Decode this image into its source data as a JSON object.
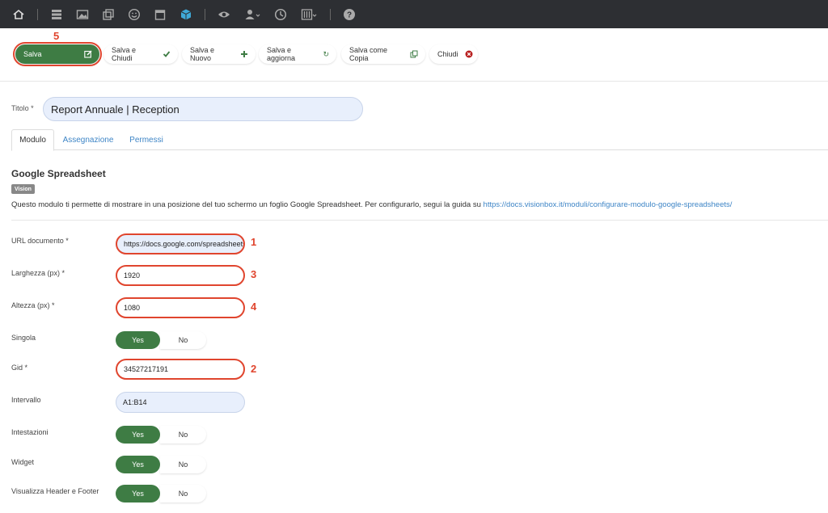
{
  "topbar": {
    "icons": [
      "home-icon",
      "list-icon",
      "image-icon",
      "copy-icon",
      "smile-icon",
      "calendar-icon",
      "cube-icon",
      "eye-icon",
      "user-icon",
      "clock-icon",
      "sliders-icon",
      "help-icon"
    ]
  },
  "toolbar": {
    "save": "Salva",
    "save_close": "Salva e Chiudi",
    "save_new": "Salva e Nuovo",
    "save_update": "Salva e aggiorna",
    "save_copy": "Salva come Copia",
    "close": "Chiudi"
  },
  "markers": {
    "m5": "5",
    "m1": "1",
    "m3": "3",
    "m4": "4",
    "m2": "2"
  },
  "title": {
    "label": "Titolo *",
    "value": "Report Annuale | Reception"
  },
  "tabs": [
    "Modulo",
    "Assegnazione",
    "Permessi"
  ],
  "section": {
    "title": "Google Spreadsheet",
    "badge": "Vision",
    "description": "Questo modulo ti permette di mostrare in una posizione del tuo schermo un foglio Google Spreadsheet. Per configurarlo, segui la guida su ",
    "link": "https://docs.visionbox.it/moduli/configurare-modulo-google-spreadsheets/"
  },
  "fields": {
    "url": {
      "label": "URL documento *",
      "value": "https://docs.google.com/spreadsheets"
    },
    "width": {
      "label": "Larghezza (px) *",
      "value": "1920"
    },
    "height": {
      "label": "Altezza (px) *",
      "value": "1080"
    },
    "single": {
      "label": "Singola",
      "yes": "Yes",
      "no": "No"
    },
    "gid": {
      "label": "Gid *",
      "value": "34527217191"
    },
    "interval": {
      "label": "Intervallo",
      "value": "A1:B14"
    },
    "headers": {
      "label": "Intestazioni",
      "yes": "Yes",
      "no": "No"
    },
    "widget": {
      "label": "Widget",
      "yes": "Yes",
      "no": "No"
    },
    "header_footer": {
      "label": "Visualizza Header e Footer",
      "yes": "Yes",
      "no": "No"
    }
  },
  "colors": {
    "accent_green": "#3e7c44",
    "highlight_red": "#e0452e",
    "link_blue": "#3e85c6",
    "topbar": "#2d2f33"
  }
}
